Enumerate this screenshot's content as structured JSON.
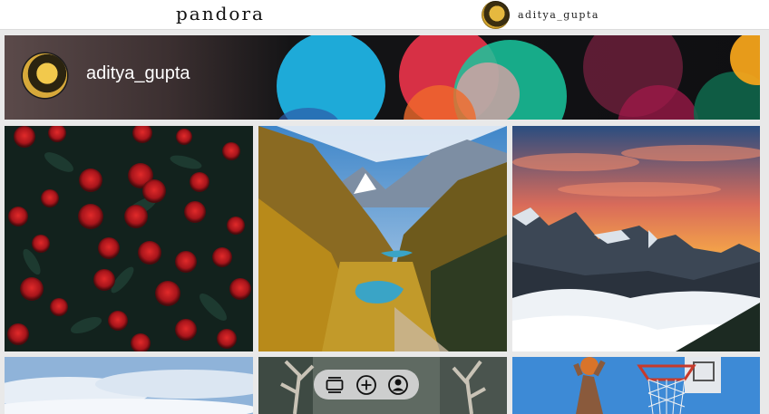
{
  "header": {
    "brand": "pandora",
    "username": "aditya_gupta",
    "avatar_icon": "user-avatar"
  },
  "banner": {
    "username": "aditya_gupta",
    "background": "bokeh-lights"
  },
  "feed": {
    "tiles": [
      {
        "subject": "red-roses"
      },
      {
        "subject": "mountain-valley-lake"
      },
      {
        "subject": "mountains-sunset-clouds"
      },
      {
        "subject": "sky-clouds"
      },
      {
        "subject": "deer-antlers-forest"
      },
      {
        "subject": "basketball-dunk"
      }
    ]
  },
  "bottom_nav": {
    "items": [
      {
        "icon": "feed-icon"
      },
      {
        "icon": "add-post-icon"
      },
      {
        "icon": "profile-icon"
      }
    ]
  },
  "colors": {
    "page_bg": "#e9e9e9",
    "header_bg": "#ffffff",
    "pill_bg": "#d7d7d7"
  }
}
